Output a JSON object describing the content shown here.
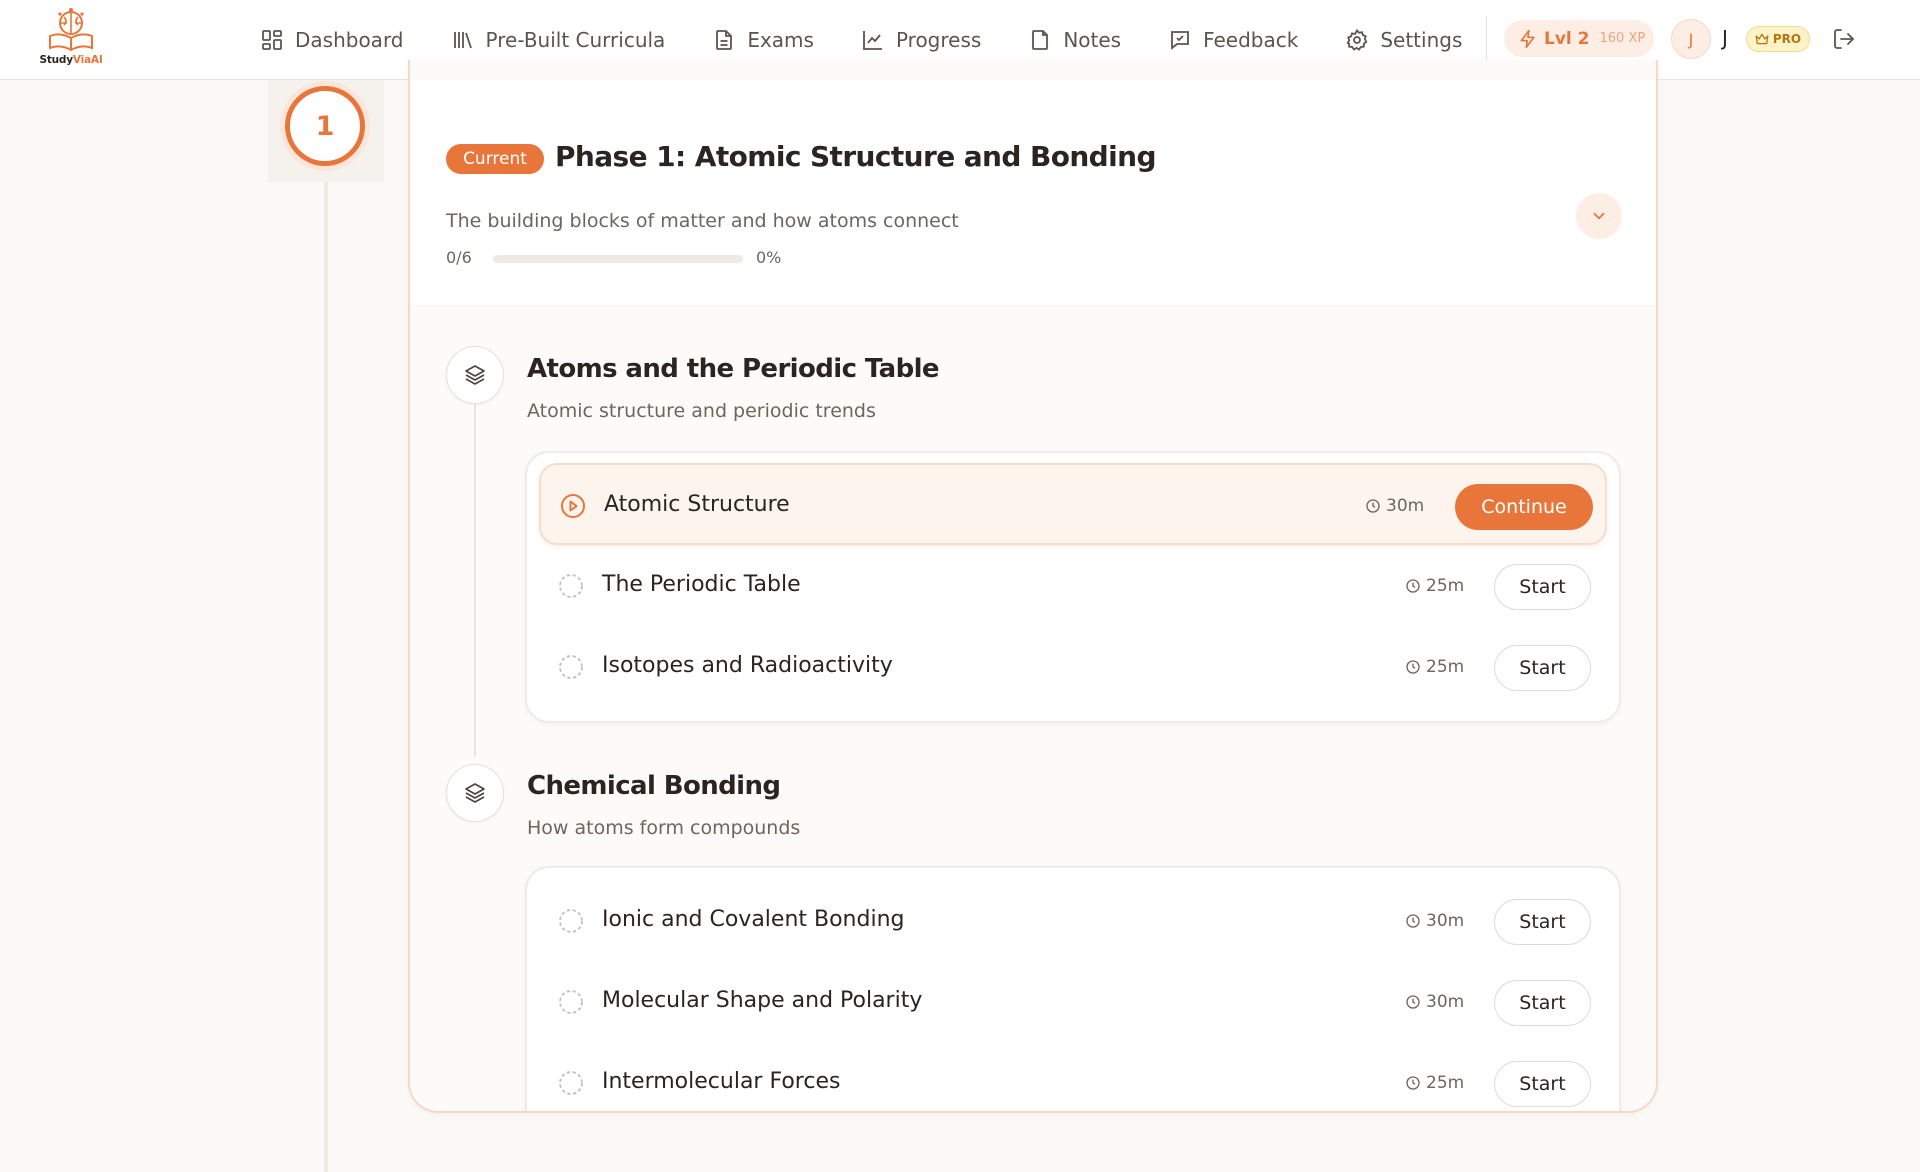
{
  "brand": {
    "name_part1": "Study",
    "name_part2": "ViaAI",
    "accent": "#e8763a"
  },
  "nav": {
    "items": [
      {
        "label": "Dashboard",
        "icon": "dashboard-icon"
      },
      {
        "label": "Pre-Built Curricula",
        "icon": "library-icon"
      },
      {
        "label": "Exams",
        "icon": "document-icon"
      },
      {
        "label": "Progress",
        "icon": "chart-line-icon"
      },
      {
        "label": "Notes",
        "icon": "note-icon"
      },
      {
        "label": "Feedback",
        "icon": "message-icon"
      },
      {
        "label": "Settings",
        "icon": "gear-icon"
      }
    ],
    "level": "Lvl 2",
    "xp": "160 XP",
    "avatar_initial": "J",
    "user_name": "J",
    "pro_label": "PRO"
  },
  "phase": {
    "number": "1",
    "badge": "Current",
    "title": "Phase 1: Atomic Structure and Bonding",
    "description": "The building blocks of matter and how atoms connect",
    "progress_count": "0/6",
    "progress_percent_label": "0%",
    "progress_fraction": 0
  },
  "modules": [
    {
      "title": "Atoms and the Periodic Table",
      "description": "Atomic structure and periodic trends",
      "lessons": [
        {
          "title": "Atomic Structure",
          "duration": "30m",
          "action": "Continue",
          "status": "in-progress"
        },
        {
          "title": "The Periodic Table",
          "duration": "25m",
          "action": "Start",
          "status": "not-started"
        },
        {
          "title": "Isotopes and Radioactivity",
          "duration": "25m",
          "action": "Start",
          "status": "not-started"
        }
      ]
    },
    {
      "title": "Chemical Bonding",
      "description": "How atoms form compounds",
      "lessons": [
        {
          "title": "Ionic and Covalent Bonding",
          "duration": "30m",
          "action": "Start",
          "status": "not-started"
        },
        {
          "title": "Molecular Shape and Polarity",
          "duration": "30m",
          "action": "Start",
          "status": "not-started"
        },
        {
          "title": "Intermolecular Forces",
          "duration": "25m",
          "action": "Start",
          "status": "not-started"
        }
      ]
    }
  ]
}
